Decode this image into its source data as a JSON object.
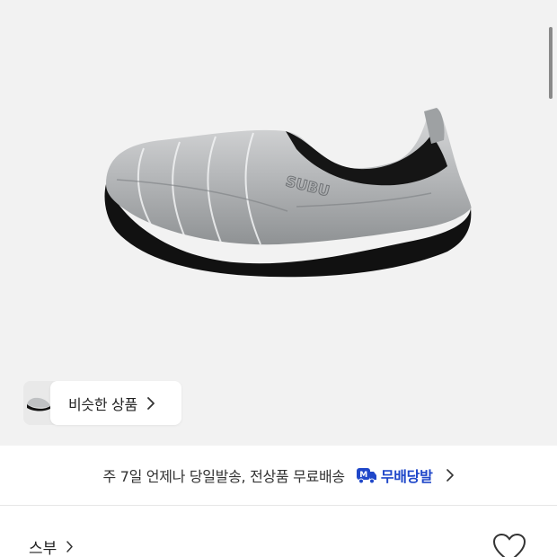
{
  "product_image": {
    "alt": "silver quilted slip-on shoe",
    "logo_text": "SUBU"
  },
  "similar_products": {
    "label": "비슷한 상품",
    "chevron_icon": "chevron-right-icon"
  },
  "delivery": {
    "text": "주 7일 언제나 당일발송, 전상품 무료배송",
    "badge_icon": "truck-m-icon",
    "badge_label": "무배당발",
    "badge_color": "#1f47c9",
    "chevron_icon": "chevron-right-icon"
  },
  "brand": {
    "name": "스부",
    "chevron_icon": "chevron-right-icon"
  },
  "wishlist": {
    "icon": "heart-icon"
  }
}
